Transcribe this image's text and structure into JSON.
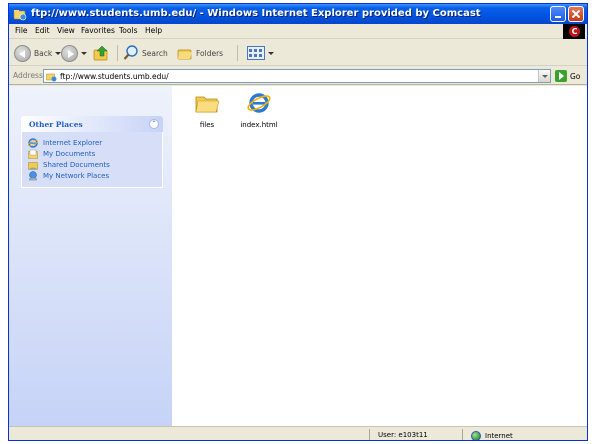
{
  "window": {
    "title": "ftp://www.students.umb.edu/ - Windows Internet Explorer provided by Comcast"
  },
  "menu": {
    "items": [
      "File",
      "Edit",
      "View",
      "Favorites",
      "Tools",
      "Help"
    ]
  },
  "toolbar": {
    "back_label": "Back",
    "search_label": "Search",
    "folders_label": "Folders"
  },
  "address": {
    "label": "Address",
    "value": "ftp://www.students.umb.edu/",
    "go_label": "Go"
  },
  "sidebar": {
    "panel_title": "Other Places",
    "links": [
      {
        "label": "Internet Explorer",
        "icon": "ie-icon"
      },
      {
        "label": "My Documents",
        "icon": "my-documents-icon"
      },
      {
        "label": "Shared Documents",
        "icon": "shared-documents-icon"
      },
      {
        "label": "My Network Places",
        "icon": "network-places-icon"
      }
    ]
  },
  "files": [
    {
      "label": "files",
      "icon": "folder-icon"
    },
    {
      "label": "index.html",
      "icon": "ie-html-icon"
    }
  ],
  "status": {
    "user": "User: e103t11",
    "zone": "Internet"
  },
  "colors": {
    "titlebar": "#0054e3",
    "sidebar_link": "#215dc6",
    "chrome": "#ece9d8"
  }
}
